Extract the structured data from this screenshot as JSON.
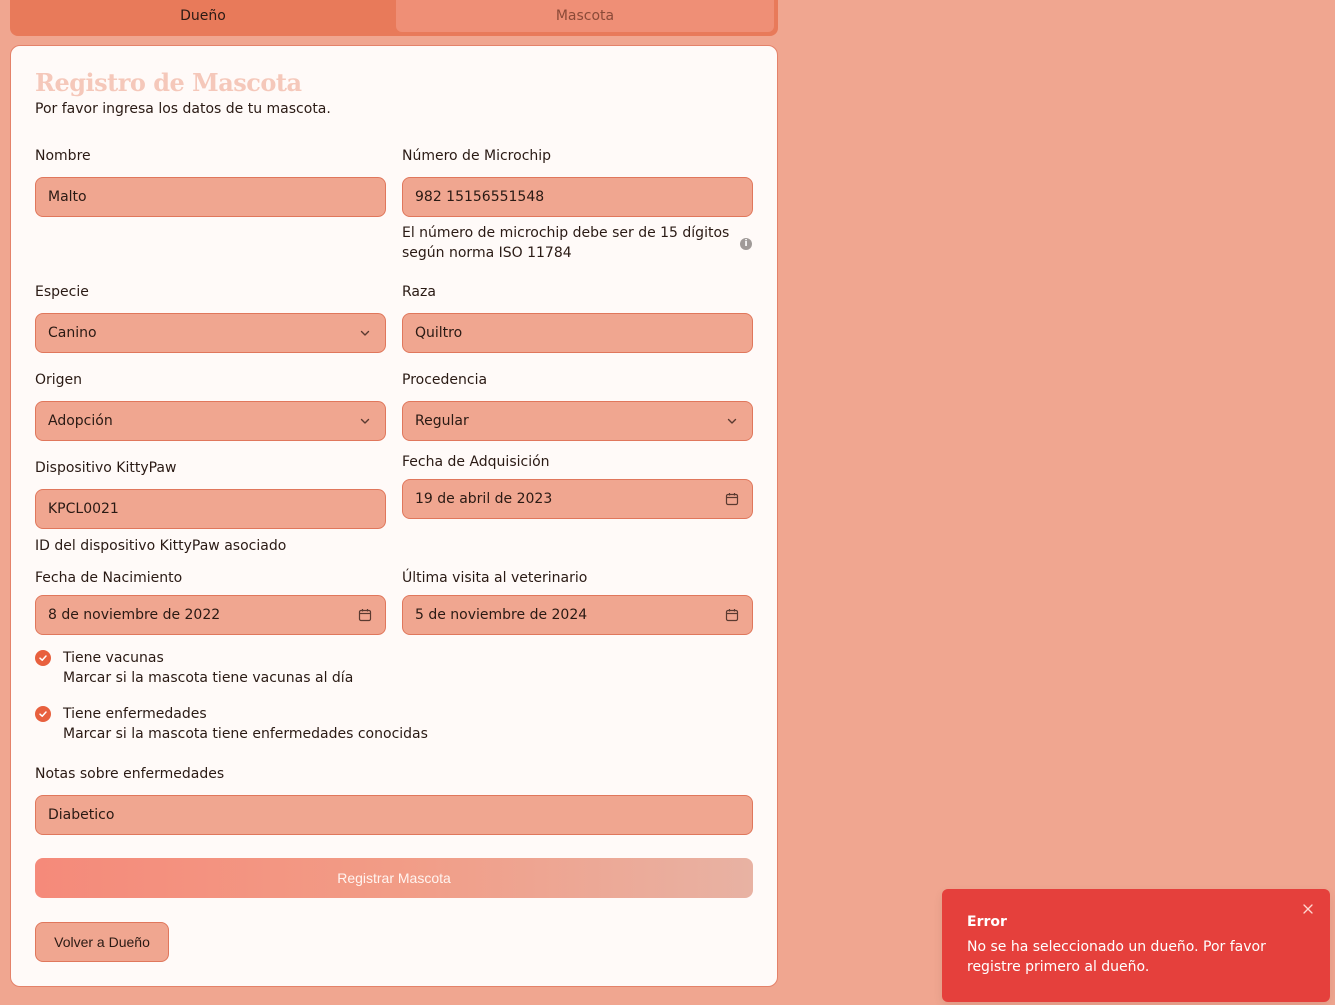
{
  "tabs": {
    "owner": "Dueño",
    "pet": "Mascota"
  },
  "form": {
    "title": "Registro de Mascota",
    "subtitle": "Por favor ingresa los datos de tu mascota.",
    "name": {
      "label": "Nombre",
      "value": "Malto"
    },
    "microchip": {
      "label": "Número de Microchip",
      "value": "982 15156551548",
      "help_line1": "El número de microchip debe ser de 15 dígitos",
      "help_line2": "según norma ISO 11784"
    },
    "species": {
      "label": "Especie",
      "value": "Canino"
    },
    "breed": {
      "label": "Raza",
      "value": "Quiltro"
    },
    "origin": {
      "label": "Origen",
      "value": "Adopción"
    },
    "provenance": {
      "label": "Procedencia",
      "value": "Regular"
    },
    "device": {
      "label": "Dispositivo KittyPaw",
      "value": "KPCL0021",
      "help": "ID del dispositivo KittyPaw asociado"
    },
    "acquisition_date": {
      "label": "Fecha de Adquisición",
      "value": "19 de abril de 2023"
    },
    "birth_date": {
      "label": "Fecha de Nacimiento",
      "value": "8 de noviembre de 2022"
    },
    "last_vet_visit": {
      "label": "Última visita al veterinario",
      "value": "5 de noviembre de 2024"
    },
    "vaccines": {
      "label": "Tiene vacunas",
      "description": "Marcar si la mascota tiene vacunas al día",
      "checked": true
    },
    "diseases": {
      "label": "Tiene enfermedades",
      "description": "Marcar si la mascota tiene enfermedades conocidas",
      "checked": true
    },
    "disease_notes": {
      "label": "Notas sobre enfermedades",
      "value": "Diabetico"
    },
    "submit_label": "Registrar Mascota",
    "back_label": "Volver a Dueño"
  },
  "toast": {
    "title": "Error",
    "message": "No se ha seleccionado un dueño. Por favor registre primero al dueño."
  },
  "colors": {
    "background": "#f0a690",
    "accent": "#e87a5a",
    "card": "#fffaf8",
    "error": "#e5403c"
  },
  "icons": [
    "chevron-down-icon",
    "calendar-icon",
    "info-icon",
    "check-icon",
    "close-icon"
  ]
}
